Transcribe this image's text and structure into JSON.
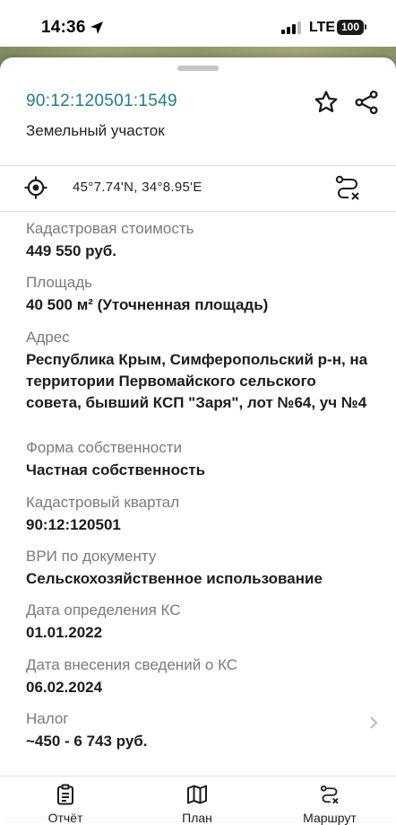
{
  "status_bar": {
    "time": "14:36",
    "network": "LTE",
    "battery": "100"
  },
  "header": {
    "cadastral_number": "90:12:120501:1549",
    "object_type": "Земельный участок",
    "accent_color": "#1a7f99"
  },
  "location": {
    "coordinates": "45°7.74'N, 34°8.95'E"
  },
  "fields": [
    {
      "label": "Кадастровая стоимость",
      "value": "449 550 руб."
    },
    {
      "label": "Площадь",
      "value": "40 500 м² (Уточненная площадь)"
    },
    {
      "label": "Адрес",
      "value": "Республика Крым, Симферопольский р-н, на территории Первомайского сельского совета, бывший КСП \"Заря\", лот №64, уч №4"
    },
    {
      "label": "Форма собственности",
      "value": "Частная собственность"
    },
    {
      "label": "Кадастровый квартал",
      "value": "90:12:120501"
    },
    {
      "label": "ВРИ по документу",
      "value": "Сельскохозяйственное использование"
    },
    {
      "label": "Дата определения КС",
      "value": "01.01.2022"
    },
    {
      "label": "Дата внесения сведений о КС",
      "value": "06.02.2024"
    },
    {
      "label": "Налог",
      "value": "~450 - 6 743 руб."
    }
  ],
  "bottom_nav": [
    {
      "label": "Отчёт",
      "icon": "report-icon"
    },
    {
      "label": "План",
      "icon": "map-icon"
    },
    {
      "label": "Маршрут",
      "icon": "route-icon"
    }
  ]
}
